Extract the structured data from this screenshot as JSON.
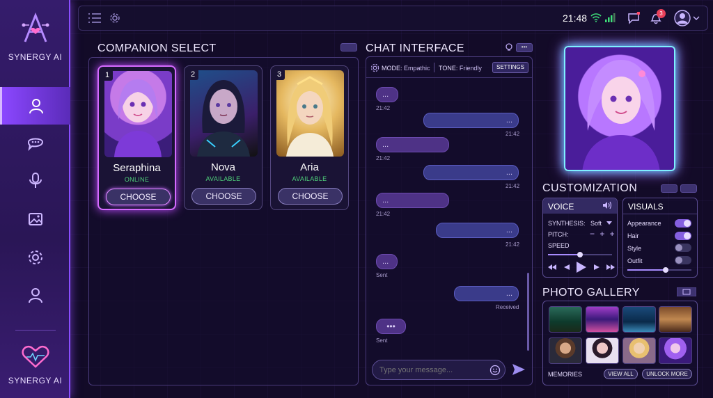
{
  "brand": {
    "name": "SYNERGY AI"
  },
  "nav": [
    {
      "icon": "user-icon"
    },
    {
      "icon": "chat-icon"
    },
    {
      "icon": "microphone-icon"
    },
    {
      "icon": "gallery-icon"
    },
    {
      "icon": "settings-icon"
    },
    {
      "icon": "profile-icon"
    }
  ],
  "topbar": {
    "time": "21:48",
    "notifications": "3"
  },
  "companion": {
    "title": "COMPANION SELECT",
    "cards": [
      {
        "num": "1",
        "name": "Seraphina",
        "status": "ONLINE",
        "button": "CHOOSE"
      },
      {
        "num": "2",
        "name": "Nova",
        "status": "AVAILABLE",
        "button": "CHOOSE"
      },
      {
        "num": "3",
        "name": "Aria",
        "status": "AVAILABLE",
        "button": "CHOOSE"
      }
    ]
  },
  "chat": {
    "title": "CHAT INTERFACE",
    "mode_label": "MODE:",
    "mode_value": "Empathic",
    "tone_label": "TONE:",
    "tone_value": "Friendly",
    "settings": "SETTINGS",
    "messages": [
      {
        "text": "...",
        "time": "21:42"
      },
      {
        "text": "...",
        "time": "21:42"
      },
      {
        "text": "...",
        "time": "21:42"
      },
      {
        "text": "...",
        "time": "21:42"
      },
      {
        "text": "...",
        "time": "21:42"
      },
      {
        "text": "...",
        "time": "21:42"
      },
      {
        "text": "...",
        "time": "Sent"
      },
      {
        "text": "...",
        "time": "Received"
      },
      {
        "text": "•••",
        "time": "Sent"
      }
    ],
    "placeholder": "Type your message..."
  },
  "customization": {
    "title": "CUSTOMIZATION",
    "voice": {
      "title": "VOICE",
      "synthesis_label": "SYNTHESIS:",
      "synthesis_value": "Soft",
      "pitch_label": "PITCH:",
      "pitch_controls": "− + +",
      "speed_label": "SPEED",
      "speed_level": 0.5
    },
    "visuals": {
      "title": "VISUALS",
      "items": [
        {
          "label": "Appearance",
          "on": true
        },
        {
          "label": "Hair",
          "on": true
        },
        {
          "label": "Style",
          "on": false
        },
        {
          "label": "Outfit",
          "on": false
        }
      ],
      "slider_level": 0.6
    }
  },
  "gallery": {
    "title": "PHOTO GALLERY",
    "memories": "MEMORIES",
    "view_all": "VIEW ALL",
    "unlock": "UNLOCK MORE"
  },
  "colors": {
    "accent": "#8b47ff",
    "glow": "#d56bff",
    "online": "#4fd17a"
  }
}
